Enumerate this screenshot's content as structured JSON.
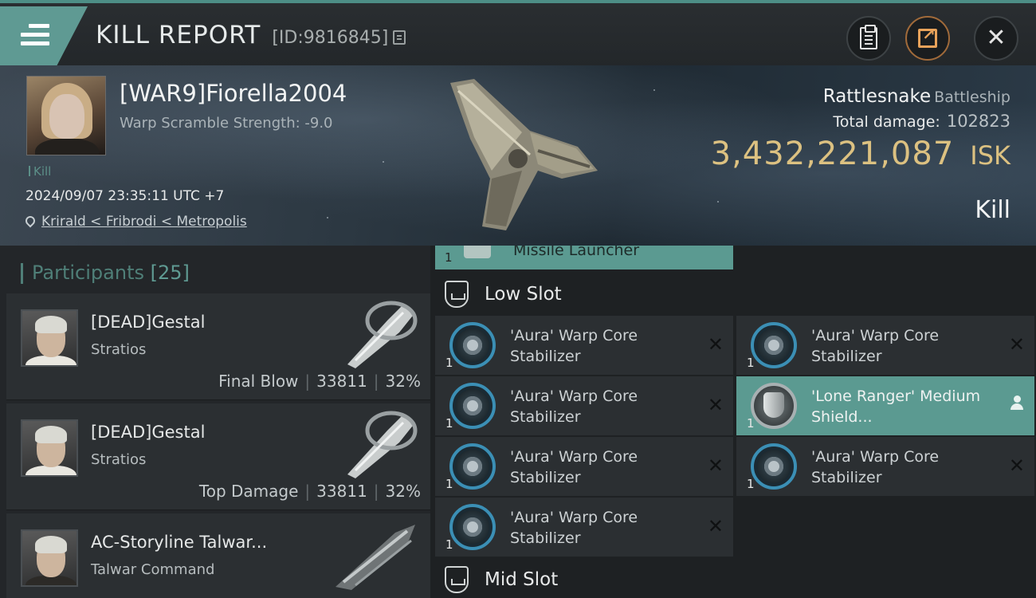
{
  "header": {
    "title": "KILL REPORT",
    "report_id": "[ID:9816845]"
  },
  "victim": {
    "name": "[WAR9]Fiorella2004",
    "stat": "Warp Scramble Strength: -9.0",
    "tag": "Kill",
    "datetime": "2024/09/07 23:35:11 UTC +7",
    "location": "Krirald < Fribrodi < Metropolis"
  },
  "ship": {
    "name": "Rattlesnake",
    "class": "Battleship",
    "damage_label": "Total damage:",
    "damage_value": "102823",
    "isk_value": "3,432,221,087",
    "isk_unit": "ISK",
    "result": "Kill"
  },
  "participants": {
    "label": "Participants",
    "count": "[25]",
    "items": [
      {
        "name": "[DEAD]Gestal",
        "ship": "Stratios",
        "role": "Final Blow",
        "damage": "33811",
        "percent": "32%"
      },
      {
        "name": "[DEAD]Gestal",
        "ship": "Stratios",
        "role": "Top Damage",
        "damage": "33811",
        "percent": "32%"
      },
      {
        "name": "AC-Storyline Talwar...",
        "ship": "Talwar Command"
      }
    ]
  },
  "slots": {
    "partial_item": {
      "qty": "1",
      "name": "Missile Launcher"
    },
    "low_slot": {
      "label": "Low Slot",
      "left": [
        {
          "qty": "1",
          "name": "'Aura' Warp Core Stabilizer"
        },
        {
          "qty": "1",
          "name": "'Aura' Warp Core Stabilizer"
        },
        {
          "qty": "1",
          "name": "'Aura' Warp Core Stabilizer"
        },
        {
          "qty": "1",
          "name": "'Aura' Warp Core Stabilizer"
        }
      ],
      "right": [
        {
          "qty": "1",
          "name": "'Aura' Warp Core Stabilizer"
        },
        {
          "qty": "1",
          "name": "'Lone Ranger' Medium Shield..."
        },
        {
          "qty": "1",
          "name": "'Aura' Warp Core Stabilizer"
        }
      ]
    },
    "mid_slot": {
      "label": "Mid Slot"
    }
  },
  "icons": {
    "menu": "hamburger-menu-icon",
    "copy": "copy-icon",
    "clipboard": "clipboard-icon",
    "share": "share-icon",
    "close": "close-icon",
    "pin": "location-pin-icon",
    "destroyed": "x-icon",
    "pilot": "person-icon"
  },
  "colors": {
    "accent": "#5f9a93",
    "isk": "#dcc181",
    "highlight": "#5b9a91"
  }
}
